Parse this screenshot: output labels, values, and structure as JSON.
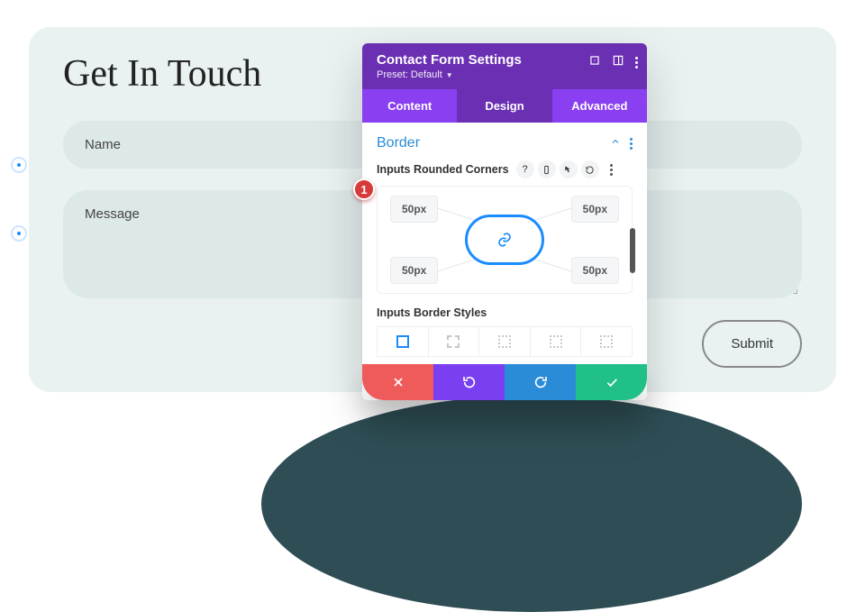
{
  "page": {
    "heading": "Get In Touch",
    "name_placeholder": "Name",
    "message_placeholder": "Message",
    "submit_label": "Submit"
  },
  "modal": {
    "title": "Contact Form Settings",
    "preset_label": "Preset: Default",
    "tabs": {
      "content": "Content",
      "design": "Design",
      "advanced": "Advanced"
    },
    "section_title": "Border",
    "option_label": "Inputs Rounded Corners",
    "corners": {
      "tl": "50px",
      "tr": "50px",
      "bl": "50px",
      "br": "50px"
    },
    "styles_label": "Inputs Border Styles"
  },
  "marker": "1"
}
